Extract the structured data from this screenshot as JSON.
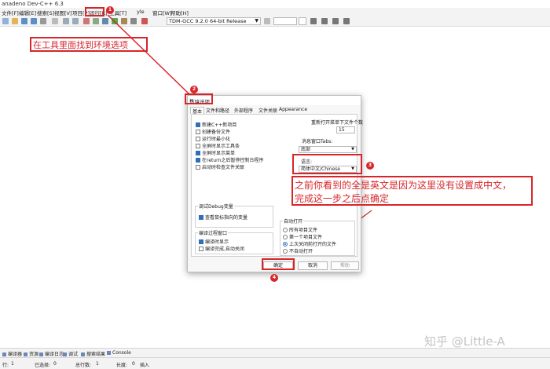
{
  "window": {
    "title": "anadeno Dev-C++ 6.3"
  },
  "menu": [
    "文件[F]",
    "编辑[E]",
    "搜索[S]",
    "视图[V]",
    "项目[P]",
    "运行[R]",
    "工具[T]",
    "yle",
    "窗口[W]",
    "帮助[H]"
  ],
  "toolbar": {
    "compiler": "TDM-GCC 9.2.0 64-bit Release"
  },
  "annotations": {
    "top_note": "在工具里面找到环境选项",
    "middle_note_line1": "之前你看到的全是英文是因为这里没有设置成中文，",
    "middle_note_line2": "完成这一步之后点确定",
    "badges": [
      "1",
      "2",
      "3",
      "4"
    ],
    "color": "#d7262b"
  },
  "dialog": {
    "title": "环境选项",
    "tabs": [
      "基本",
      "文件和路径",
      "外部程序",
      "文件关联",
      "Appearance"
    ],
    "checkboxes": [
      {
        "label": "新建C++新项目",
        "checked": true
      },
      {
        "label": "创建备份文件",
        "checked": false
      },
      {
        "label": "运行时最小化",
        "checked": false
      },
      {
        "label": "全屏时显示工具条",
        "checked": false
      },
      {
        "label": "全屏时显示菜单",
        "checked": true
      },
      {
        "label": "在return之后暂停控制台程序",
        "checked": true
      },
      {
        "label": "启动时检查文件关联",
        "checked": false
      }
    ],
    "reopen_label": "重新打开菜单下文件个数",
    "reopen_value": "15",
    "msgwin_label": "消息窗口Tabs:",
    "msgwin_value": "底部",
    "language_label": "语言:",
    "language_value": "简体中文/Chinese",
    "debug_group": {
      "title": "调试Debug变量",
      "option": "查看鼠标指向的变量",
      "checked": true
    },
    "compile_group": {
      "title": "编译过程窗口",
      "options": [
        {
          "label": "编译时显示",
          "checked": true
        },
        {
          "label": "编译完成,自动关闭",
          "checked": false
        }
      ]
    },
    "autoopen_group": {
      "title": "自动打开",
      "options": [
        {
          "label": "所有项目文件",
          "selected": false
        },
        {
          "label": "第一个项目文件",
          "selected": false
        },
        {
          "label": "上次关闭前打开的文件",
          "selected": true
        },
        {
          "label": "不自动打开",
          "selected": false
        }
      ]
    },
    "buttons": {
      "ok": "确定",
      "cancel": "取消",
      "help": "帮助"
    }
  },
  "bottom_tabs": [
    "编译器",
    "资源",
    "编译日志",
    "调试",
    "搜索结果",
    "Console"
  ],
  "status": {
    "row_label": "行:",
    "row_value": "1",
    "selected_label": "已选择:",
    "selected_value": "0",
    "total_label": "总行数:",
    "total_value": "1",
    "length_label": "长度:",
    "length_value": "0",
    "mode": "插入"
  },
  "watermark": "知乎 @Little-A"
}
